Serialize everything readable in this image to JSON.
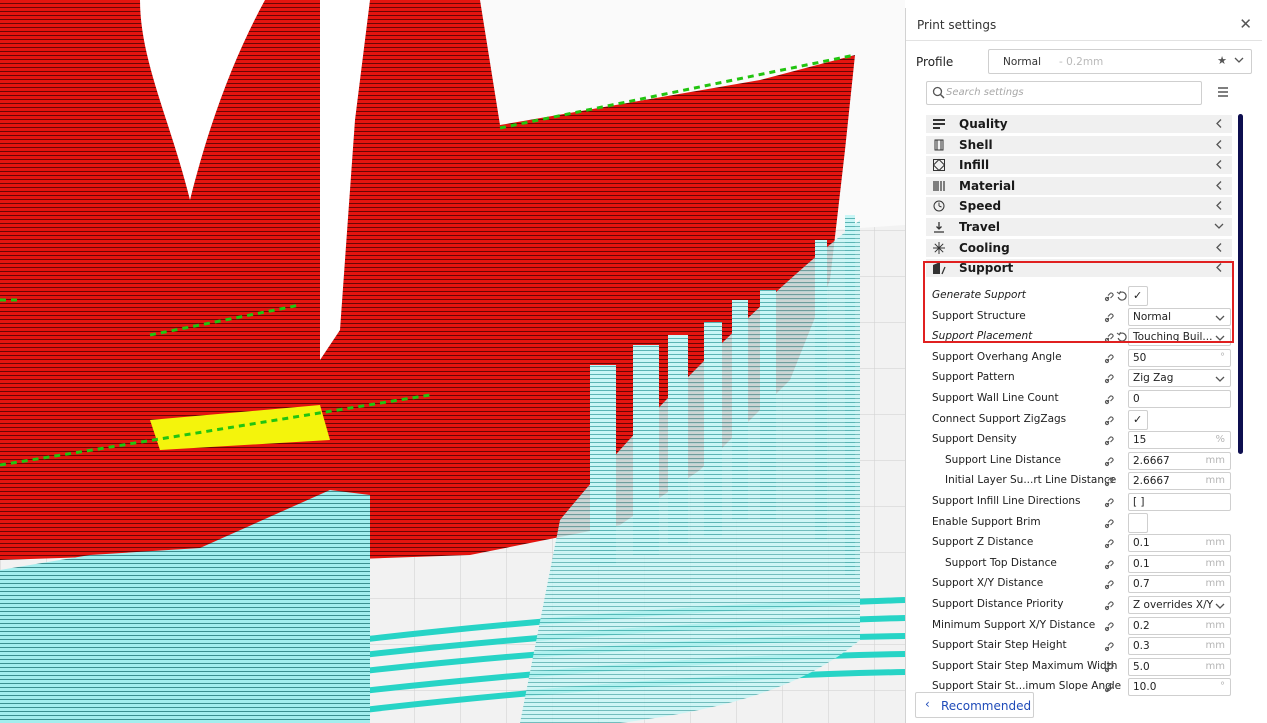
{
  "panel": {
    "title": "Print settings",
    "close_glyph": "✕",
    "profile_label": "Profile",
    "profile_name": "Normal",
    "profile_sub": "- 0.2mm",
    "star_glyph": "★",
    "search_placeholder": "Search settings"
  },
  "categories": [
    {
      "label": "Quality",
      "icon": "quality-icon",
      "state": "collapsed"
    },
    {
      "label": "Shell",
      "icon": "shell-icon",
      "state": "collapsed"
    },
    {
      "label": "Infill",
      "icon": "infill-icon",
      "state": "collapsed"
    },
    {
      "label": "Material",
      "icon": "material-icon",
      "state": "collapsed"
    },
    {
      "label": "Speed",
      "icon": "speed-icon",
      "state": "collapsed"
    },
    {
      "label": "Travel",
      "icon": "travel-icon",
      "state": "expanded"
    },
    {
      "label": "Cooling",
      "icon": "cooling-icon",
      "state": "collapsed"
    },
    {
      "label": "Support",
      "icon": "support-icon",
      "state": "collapsed"
    }
  ],
  "support_settings": [
    {
      "label": "Generate Support",
      "type": "checkbox",
      "value": "✓",
      "italic": true,
      "reset": true
    },
    {
      "label": "Support Structure",
      "type": "select",
      "value": "Normal"
    },
    {
      "label": "Support Placement",
      "type": "select",
      "value": "Touching Buil...",
      "italic": true,
      "reset": true
    },
    {
      "label": "Support Overhang Angle",
      "type": "field",
      "value": "50",
      "unit": "°"
    },
    {
      "label": "Support Pattern",
      "type": "select",
      "value": "Zig Zag"
    },
    {
      "label": "Support Wall Line Count",
      "type": "field",
      "value": "0",
      "unit": ""
    },
    {
      "label": "Connect Support ZigZags",
      "type": "checkbox",
      "value": "✓"
    },
    {
      "label": "Support Density",
      "type": "field",
      "value": "15",
      "unit": "%"
    },
    {
      "label": "Support Line Distance",
      "type": "field",
      "value": "2.6667",
      "unit": "mm",
      "indent": true
    },
    {
      "label": "Initial Layer Su...rt Line Distance",
      "type": "field",
      "value": "2.6667",
      "unit": "mm",
      "indent": true
    },
    {
      "label": "Support Infill Line Directions",
      "type": "field",
      "value": "[ ]",
      "unit": ""
    },
    {
      "label": "Enable Support Brim",
      "type": "checkbox",
      "value": ""
    },
    {
      "label": "Support Z Distance",
      "type": "field",
      "value": "0.1",
      "unit": "mm"
    },
    {
      "label": "Support Top Distance",
      "type": "field",
      "value": "0.1",
      "unit": "mm",
      "indent": true
    },
    {
      "label": "Support X/Y Distance",
      "type": "field",
      "value": "0.7",
      "unit": "mm"
    },
    {
      "label": "Support Distance Priority",
      "type": "select",
      "value": "Z overrides X/Y"
    },
    {
      "label": "Minimum Support X/Y Distance",
      "type": "field",
      "value": "0.2",
      "unit": "mm"
    },
    {
      "label": "Support Stair Step Height",
      "type": "field",
      "value": "0.3",
      "unit": "mm"
    },
    {
      "label": "Support Stair Step Maximum Width",
      "type": "field",
      "value": "5.0",
      "unit": "mm"
    },
    {
      "label": "Support Stair St...imum Slope Angle",
      "type": "field",
      "value": "10.0",
      "unit": "°"
    }
  ],
  "footer": {
    "recommended_chevron": "‹",
    "recommended_label": "Recommended"
  },
  "colors": {
    "model_red": "#e4140f",
    "support_cyan": "#9aecec",
    "skirt_teal": "#27d4c6",
    "infill_yellow": "#f4f40c",
    "highlight_red": "#e02020",
    "scrollbar_navy": "#0d0e4f",
    "link_blue": "#1f4bb9"
  }
}
